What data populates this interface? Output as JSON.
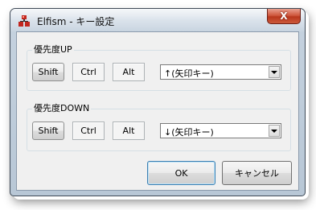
{
  "window": {
    "title": "Elfism - キー設定",
    "close_symbol": "X",
    "app_icon": "elfism-app-icon"
  },
  "groups": [
    {
      "legend": "優先度UP",
      "keys": {
        "shift": "Shift",
        "ctrl": "Ctrl",
        "alt": "Alt"
      },
      "key_value": "↑(矢印キー)"
    },
    {
      "legend": "優先度DOWN",
      "keys": {
        "shift": "Shift",
        "ctrl": "Ctrl",
        "alt": "Alt"
      },
      "key_value": "↓(矢印キー)"
    }
  ],
  "buttons": {
    "ok": "OK",
    "cancel": "キャンセル"
  },
  "colors": {
    "close_button": "#c8452a",
    "default_button_border": "#3c7fb1",
    "dialog_background": "#f0f0f0"
  }
}
